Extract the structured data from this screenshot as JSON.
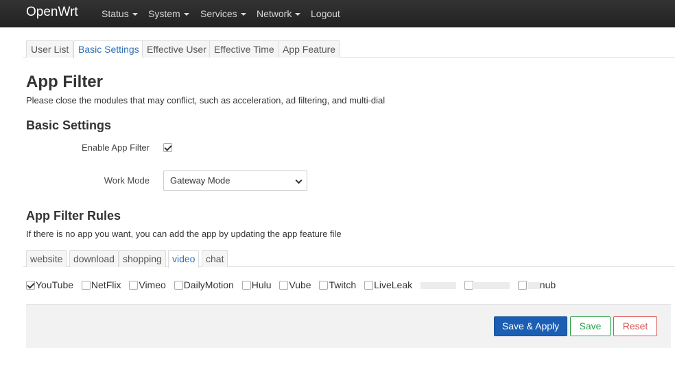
{
  "navbar": {
    "brand": "OpenWrt",
    "menu": [
      {
        "label": "Status"
      },
      {
        "label": "System"
      },
      {
        "label": "Services"
      },
      {
        "label": "Network"
      },
      {
        "label": "Logout"
      }
    ]
  },
  "tabs": [
    "User List",
    "Basic Settings",
    "Effective User",
    "Effective Time",
    "App Feature"
  ],
  "active_tab": "Basic Settings",
  "page": {
    "title": "App Filter",
    "description": "Please close the modules that may conflict, such as acceleration, ad filtering, and multi-dial"
  },
  "basic_settings": {
    "heading": "Basic Settings",
    "enable_label": "Enable App Filter",
    "enable_checked": true,
    "work_mode_label": "Work Mode",
    "work_mode_value": "Gateway Mode"
  },
  "rules": {
    "heading": "App Filter Rules",
    "description": "If there is no app you want, you can add the app by updating the app feature file",
    "tabs": [
      "website",
      "download",
      "shopping",
      "video",
      "chat"
    ],
    "active_tab": "video",
    "apps": [
      {
        "name": "YouTube",
        "checked": true
      },
      {
        "name": "NetFlix",
        "checked": false
      },
      {
        "name": "Vimeo",
        "checked": false
      },
      {
        "name": "DailyMotion",
        "checked": false
      },
      {
        "name": "Hulu",
        "checked": false
      },
      {
        "name": "Vube",
        "checked": false
      },
      {
        "name": "Twitch",
        "checked": false
      },
      {
        "name": "LiveLeak",
        "checked": false
      }
    ],
    "partially_visible_apps": [
      "nub"
    ]
  },
  "actions": {
    "save_apply": "Save & Apply",
    "save": "Save",
    "reset": "Reset"
  },
  "colors": {
    "navbar": "#222222",
    "accent": "#1a5fb4",
    "save": "#2aa34a",
    "reset": "#d9534f"
  }
}
